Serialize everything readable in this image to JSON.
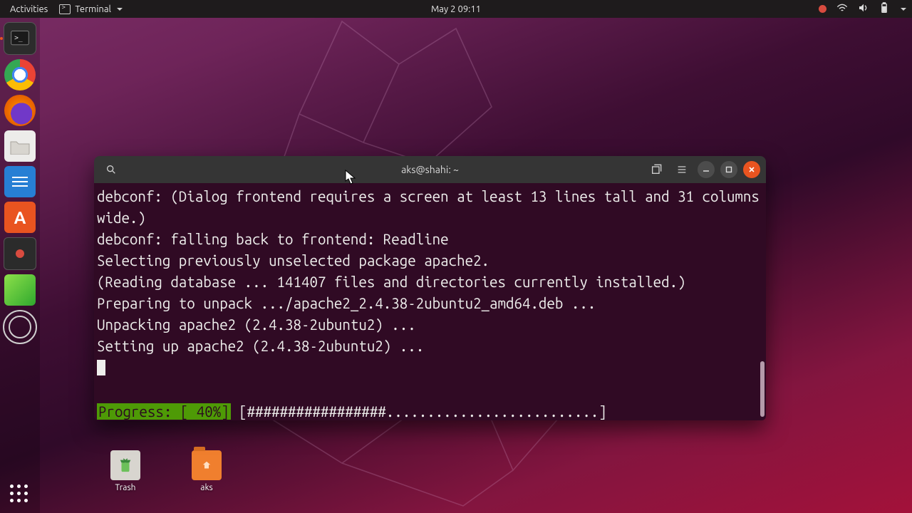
{
  "topbar": {
    "activities": "Activities",
    "appmenu": "Terminal",
    "clock": "May 2  09:11"
  },
  "launcher": {
    "items": [
      {
        "name": "terminal",
        "running": true
      },
      {
        "name": "chrome"
      },
      {
        "name": "firefox"
      },
      {
        "name": "files"
      },
      {
        "name": "libreoffice-writer"
      },
      {
        "name": "software-center",
        "label": "A"
      },
      {
        "name": "screen-recorder"
      },
      {
        "name": "green-app"
      },
      {
        "name": "settings"
      }
    ]
  },
  "desktop_icons": {
    "trash": {
      "label": "Trash"
    },
    "home": {
      "label": "aks"
    }
  },
  "terminal": {
    "title": "aks@shahi: ~",
    "lines": [
      "debconf: (Dialog frontend requires a screen at least 13 lines tall and 31 columns wide.)",
      "debconf: falling back to frontend: Readline",
      "Selecting previously unselected package apache2.",
      "(Reading database ... 141407 files and directories currently installed.)",
      "Preparing to unpack .../apache2_2.4.38-2ubuntu2_amd64.deb ...",
      "Unpacking apache2 (2.4.38-2ubuntu2) ...",
      "Setting up apache2 (2.4.38-2ubuntu2) ..."
    ],
    "progress": {
      "label": "Progress: [ 40%]",
      "percent": 40,
      "bar_filled": 17,
      "bar_total": 43
    }
  }
}
